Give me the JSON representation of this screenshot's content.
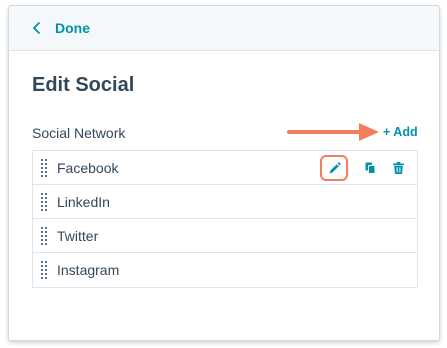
{
  "header": {
    "back_label": "Done",
    "back_icon": "chevron-left-icon"
  },
  "page": {
    "title": "Edit Social"
  },
  "social_section": {
    "label": "Social Network",
    "add_label": "+ Add",
    "items": [
      {
        "label": "Facebook"
      },
      {
        "label": "LinkedIn"
      },
      {
        "label": "Twitter"
      },
      {
        "label": "Instagram"
      }
    ]
  },
  "row_actions": [
    "pencil-icon",
    "clone-icon",
    "trash-icon"
  ],
  "colors": {
    "accent": "#0091ae",
    "text": "#33475b",
    "annotation": "#f47e5c",
    "header_bg": "#f5f8fa",
    "border": "#dfe3eb"
  }
}
